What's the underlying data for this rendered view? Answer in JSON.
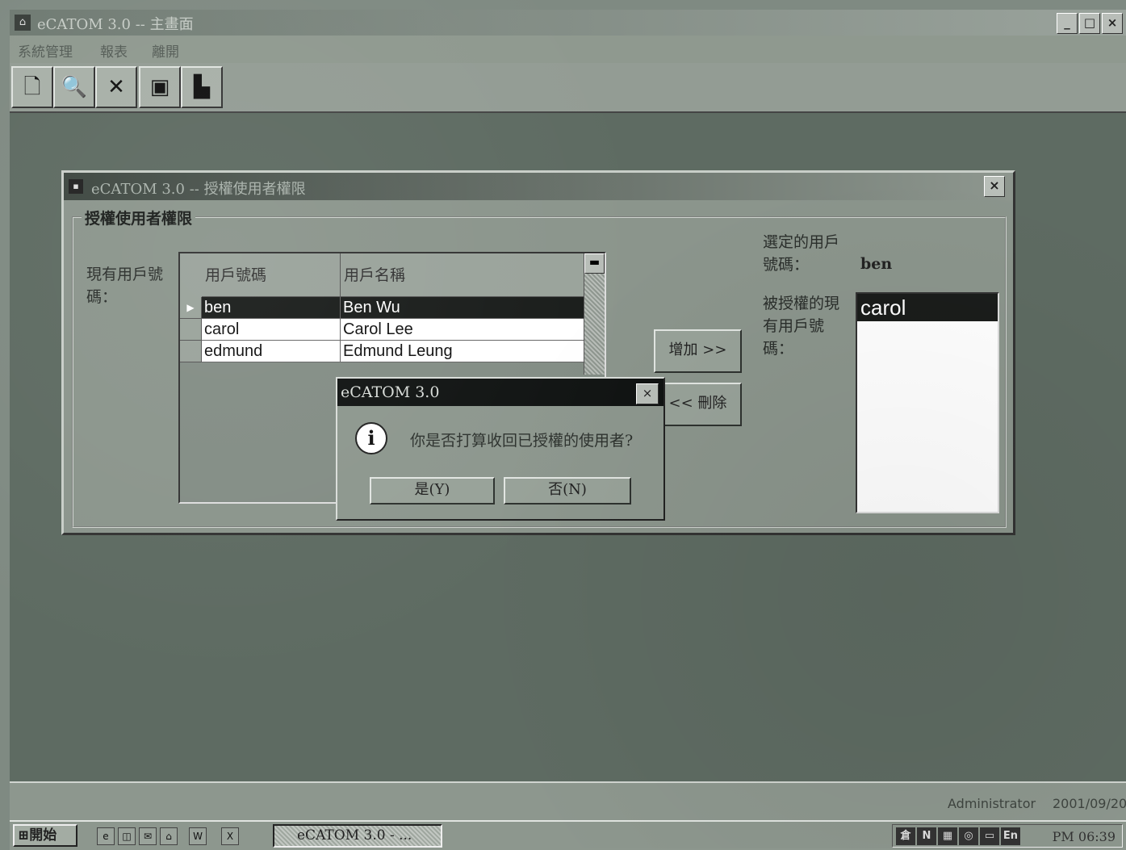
{
  "main_window": {
    "title": "eCATOM 3.0 -- 主畫面",
    "menu": [
      "系統管理",
      "報表",
      "離開"
    ],
    "controls": {
      "minimize": "_",
      "maximize": "□",
      "close": "×"
    },
    "toolbar_icons": [
      "new-document-icon",
      "find-icon",
      "delete-icon",
      "save-icon",
      "exit-icon"
    ]
  },
  "auth_dialog": {
    "title": "eCATOM 3.0 -- 授權使用者權限",
    "close": "×",
    "group_label": "授權使用者權限",
    "current_users_label": "現有用戶號碼：",
    "grid": {
      "columns": [
        "用戶號碼",
        "用戶名稱"
      ],
      "rows": [
        {
          "id": "ben",
          "name": "Ben Wu",
          "selected": true
        },
        {
          "id": "carol",
          "name": "Carol Lee",
          "selected": false
        },
        {
          "id": "edmund",
          "name": "Edmund Leung",
          "selected": false
        }
      ]
    },
    "add_button": "增加 >>",
    "remove_button": "<< 刪除",
    "selected_user_label": "選定的用戶號碼：",
    "selected_user_value": "ben",
    "granted_label": "被授權的現有用戶號碼：",
    "granted_users": [
      "carol"
    ]
  },
  "message_box": {
    "title": "eCATOM 3.0",
    "close": "×",
    "icon": "info-icon",
    "text": "你是否打算收回已授權的使用者?",
    "yes": "是(Y)",
    "no": "否(N)"
  },
  "status_bar": {
    "user": "Administrator",
    "date": "2001/09/20"
  },
  "taskbar": {
    "start": "開始",
    "task": "eCATOM 3.0 - ...",
    "clock": "PM 06:39"
  }
}
